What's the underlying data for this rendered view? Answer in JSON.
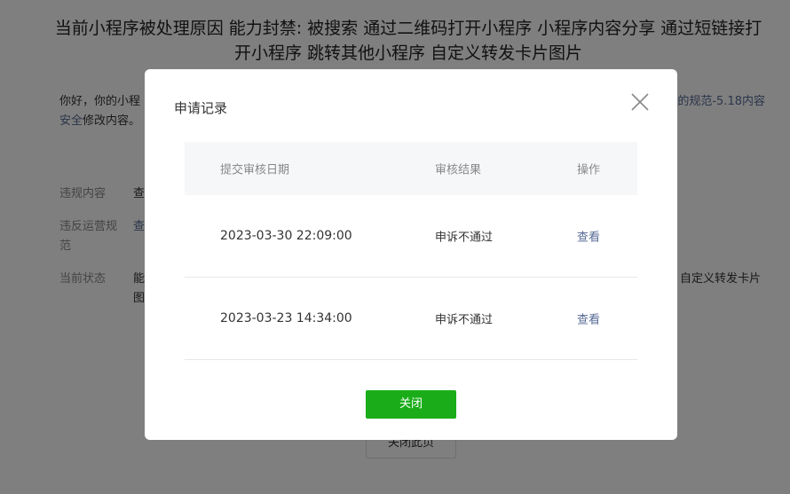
{
  "page": {
    "title": "当前小程序被处理原因 能力封禁: 被搜索 通过二维码打开小程序 小程序内容分享 通过短链接打开小程序 跳转其他小程序 自定义转发卡片图片",
    "intro_text": "你好，你的小程",
    "intro_link_right": "的规范-5.18内容",
    "intro_link_start": "安全",
    "intro_tail": "修改内容。",
    "rows": [
      {
        "label": "违规内容",
        "value": "查"
      },
      {
        "label": "违反运营规范",
        "value": "查"
      },
      {
        "label": "当前状态",
        "value": "能",
        "value_right": "自定义转发卡片",
        "value_line2": "图"
      }
    ],
    "close_page_button": "关闭此页"
  },
  "dialog": {
    "title": "申请记录",
    "columns": [
      "提交审核日期",
      "审核结果",
      "操作"
    ],
    "records": [
      {
        "date": "2023-03-30 22:09:00",
        "result": "申诉不通过",
        "action": "查看"
      },
      {
        "date": "2023-03-23 14:34:00",
        "result": "申诉不通过",
        "action": "查看"
      }
    ],
    "close_button": "关闭"
  },
  "colors": {
    "accent_green": "#1aad19",
    "link_blue": "#576b95",
    "overlay": "rgba(0,0,0,0.5)"
  },
  "icons": {
    "close": "close-icon"
  }
}
